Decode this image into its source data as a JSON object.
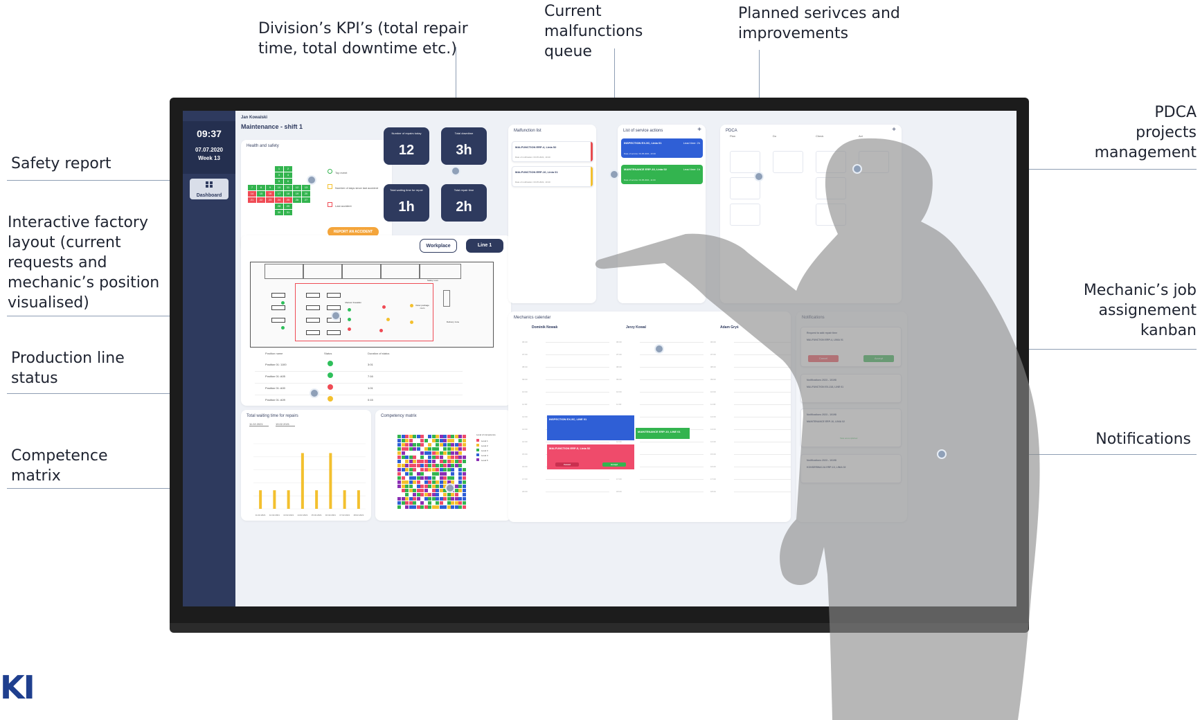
{
  "callouts": {
    "kpis": "Division’s KPI’s (total repair\ntime, total downtime etc.)",
    "malfunctions": "Current\nmalfunctions\nqueue",
    "planned": "Planned serivces and\nimprovements",
    "pdca": "PDCA\nprojects\nmanagement",
    "safety": "Safety report",
    "layout": "Interactive factory\nlayout (current\nrequests and\nmechanic’s position\nvisualised)",
    "production": "Production line\nstatus",
    "competence": "Competence\nmatrix",
    "kanban": "Mechanic’s job\nassignement\nkanban",
    "notifications": "Notifications"
  },
  "logo_text": "KI",
  "sidebar": {
    "time": "09:37",
    "date": "07.07.2020",
    "week": "Week 13",
    "dashboard_label": "Dashboard"
  },
  "header": {
    "user": "Jan Kowalski",
    "title": "Maintenance - shift 1"
  },
  "safety": {
    "title": "Health and safety",
    "cross_days": [
      "1",
      "2",
      "3",
      "4",
      "5",
      "6",
      "7",
      "8",
      "9",
      "10",
      "11",
      "12",
      "13",
      "14",
      "15",
      "16",
      "17",
      "18",
      "19",
      "20",
      "21",
      "22",
      "23",
      "24",
      "25",
      "26",
      "27",
      "28",
      "29",
      "30",
      "31"
    ],
    "legend": [
      "Top event",
      "Number of days since last accident",
      "Last accident"
    ],
    "button": "REPORT AN ACCIDENT"
  },
  "kpis": [
    {
      "label": "Number of repairs today",
      "value": "12"
    },
    {
      "label": "Total downtime",
      "value": "3h"
    },
    {
      "label": "Total waiting time for repair",
      "value": "1h"
    },
    {
      "label": "Total repair time",
      "value": "2h"
    }
  ],
  "layout": {
    "buttons": [
      "Workplace",
      "Line 1"
    ],
    "labels": [
      "Safety room",
      "Mariusz Kowalski",
      "Outer package room",
      "Delivery zone"
    ]
  },
  "production_status": {
    "headers": [
      "Position name",
      "Status",
      "Duration of status"
    ],
    "rows": [
      {
        "name": "Position 01: 1100",
        "color": "#2fbf5b",
        "duration": "3:01"
      },
      {
        "name": "Position 01: A05",
        "color": "#2fbf5b",
        "duration": "7:16"
      },
      {
        "name": "Position 01: A00",
        "color": "#ef4b55",
        "duration": "1:01"
      },
      {
        "name": "Position 01: A09",
        "color": "#f3c02e",
        "duration": "0:15"
      }
    ]
  },
  "malfunctions": {
    "title": "Malfunction list",
    "items": [
      {
        "title": "MALFUNCTION ERP-4, Linia 52",
        "sub": "Date of notification: 03.05.2021, 10:40"
      },
      {
        "title": "MALFUNCTION ERP-10, Linia 01",
        "sub": "Date of notification: 03.05.2021, 10:40"
      }
    ]
  },
  "services": {
    "title": "List of service actions",
    "add": "+",
    "items": [
      {
        "title": "INSPECTION EX-5C, Linia 01",
        "lead": "Lead time: 2h",
        "date": "Date of service: 03.05.2021, 10:40",
        "color": "#2f5fd6"
      },
      {
        "title": "MAINTENANCE ERP-10, Linia 02",
        "lead": "Lead time: 1h",
        "date": "Date of service: 03.05.2021, 11:00",
        "color": "#33b44f"
      }
    ]
  },
  "pdca": {
    "title": "PDCA",
    "add": "+",
    "columns": [
      "Plan",
      "Do",
      "Check",
      "Act"
    ]
  },
  "calendar": {
    "title": "Mechanics calendar",
    "people": [
      "Dominik Nowak",
      "Jerzy Kowal",
      "Adam Gryś"
    ],
    "hours": [
      "06:00",
      "07:00",
      "08:00",
      "09:00",
      "10:00",
      "11:00",
      "12:00",
      "13:00",
      "14:00",
      "15:00",
      "16:00",
      "17:00",
      "18:00"
    ],
    "events": [
      {
        "label": "INSPECTION EX-5C, LINE 01",
        "color": "#2f5fd6"
      },
      {
        "label": "MALFUNCTION ERP-5, Linia 52",
        "color": "#ef4b6b"
      },
      {
        "label": "MAINTENANCE ERP-10, LINE 01",
        "color": "#33b44f"
      }
    ],
    "event_buttons": [
      "Cancel",
      "Accept"
    ]
  },
  "notifications": {
    "title": "Notifications",
    "items": [
      {
        "title": "Request to add repair time",
        "line": "MALFUNCTION ERP-4, LINIA 01",
        "buttons": [
          "Cancel",
          "Accept"
        ]
      },
      {
        "title": "Notifications 2023 - 10198",
        "line": "MALFUNCTION EX-218, LINE 01"
      },
      {
        "title": "Notifications 2023 - 10198",
        "line": "MAINTENANCE ERP-10, LINIA 02",
        "status": "Task accomplished"
      },
      {
        "title": "Notifications 2023 - 10198",
        "line": "KONSERWACJA ERP-10, LINIA 02"
      }
    ]
  },
  "waiting_chart": {
    "title": "Total waiting time for repairs",
    "from": "11.02.2021",
    "to": "19.02.2021",
    "chart_data": {
      "type": "bar",
      "categories": [
        "11.02.2021",
        "12.02.2021",
        "13.02.2021",
        "14.02.2021",
        "15.02.2021",
        "16.02.2021",
        "17.02.2021",
        "18.02.2021"
      ],
      "series": [
        {
          "values": [
            0.4,
            0.4,
            0.4,
            1.2,
            0.4,
            1.2,
            0.4,
            0.4
          ]
        }
      ]
    }
  },
  "competency": {
    "title": "Competency matrix",
    "legend_title": "Level of competence",
    "levels": [
      {
        "label": "Level 1",
        "color": "#ef4b6b"
      },
      {
        "label": "Level 2",
        "color": "#f3c02e"
      },
      {
        "label": "Level 3",
        "color": "#33b44f"
      },
      {
        "label": "Level 4",
        "color": "#2f5fd6"
      },
      {
        "label": "Level 5",
        "color": "#8b2fb3"
      }
    ]
  }
}
